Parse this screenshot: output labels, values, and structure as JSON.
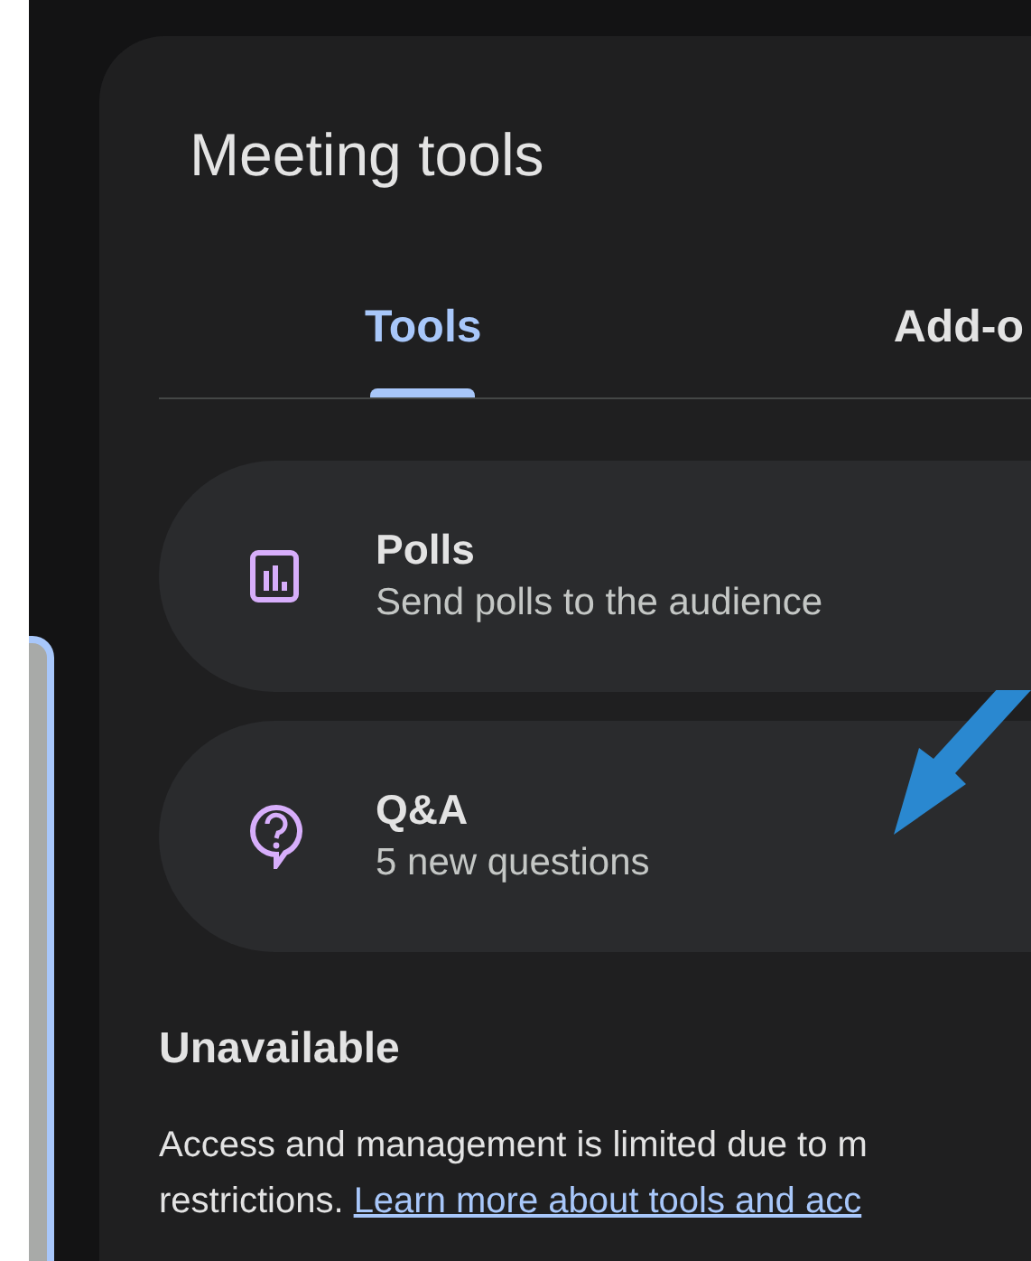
{
  "panel": {
    "title": "Meeting tools"
  },
  "tabs": [
    {
      "label": "Tools",
      "selected": true
    },
    {
      "label": "Add-o",
      "selected": false
    }
  ],
  "tools": [
    {
      "kind": "poll",
      "title": "Polls",
      "subtitle": "Send polls to the audience"
    },
    {
      "kind": "qa",
      "title": "Q&A",
      "subtitle": "5 new questions"
    }
  ],
  "unavailable": {
    "heading": "Unavailable",
    "text": "Access and management is limited due to m",
    "text_2": "restrictions.",
    "link": "Learn more about tools and acc"
  }
}
